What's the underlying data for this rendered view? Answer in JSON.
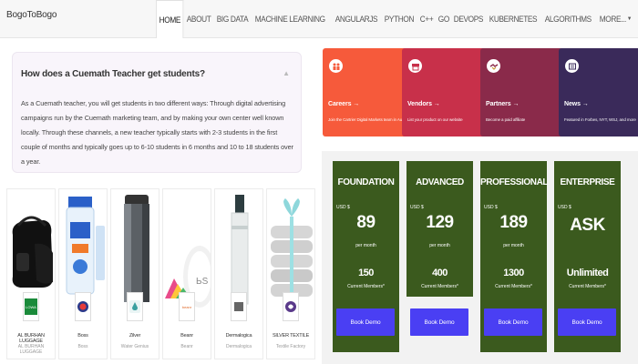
{
  "brand": "BogoToBogo",
  "nav": [
    {
      "label": "HOME",
      "active": true
    },
    {
      "label": "ABOUT"
    },
    {
      "label": "BIG DATA"
    },
    {
      "label": "MACHINE LEARNING"
    },
    {
      "label": "ANGULARJS"
    },
    {
      "label": "PYTHON"
    },
    {
      "label": "C++"
    },
    {
      "label": "GO"
    },
    {
      "label": "DEVOPS"
    },
    {
      "label": "KUBERNETES"
    },
    {
      "label": "ALGORITHMS"
    },
    {
      "label": "MORE..."
    }
  ],
  "faq": {
    "question": "How does a Cuemath Teacher get students?",
    "answer": "As a Cuemath teacher, you will get students in two different ways: Through digital advertising campaigns run by the Cuemath marketing team, and by making your own center well known locally. Through these channels, a new teacher typically starts with 2-3 students in the first couple of months and typically goes up to 6-10 students in 6 months and 10 to 18 students over a year."
  },
  "products": [
    {
      "name": "AL BURHAN LUGGAGE",
      "sub": "AL BURHAN LUGGAGE",
      "logo_text": "LOWA",
      "logo_color": "#1a8a3a"
    },
    {
      "name": "Boss",
      "sub": "Boss",
      "logo_text": "BOSS",
      "logo_color": "#2b3a8a"
    },
    {
      "name": "Zilver",
      "sub": "Water Genius",
      "logo_text": "",
      "logo_color": "#3aa0a0"
    },
    {
      "name": "Beanr",
      "sub": "Beanr",
      "logo_text": "beanr",
      "logo_color": "#e06a2a"
    },
    {
      "name": "Dermalogica",
      "sub": "Dermalogica",
      "logo_text": "",
      "logo_color": "#666666"
    },
    {
      "name": "SILVER TEXTILE",
      "sub": "Textile Factory",
      "logo_text": "",
      "logo_color": "#5a3a8a"
    }
  ],
  "tiles": [
    {
      "title": "Careers →",
      "desc": "Join the Cartrier Digital Markets team in Austin",
      "color": "#f65a3b",
      "icon": "people-icon"
    },
    {
      "title": "Vendors →",
      "desc": "List your product on our website",
      "color": "#c8304a",
      "icon": "store-icon"
    },
    {
      "title": "Partners →",
      "desc": "Become a paid affiliate",
      "color": "#8a2a4a",
      "icon": "handshake-icon"
    },
    {
      "title": "News →",
      "desc": "Featured in Forbes, NYT, WSJ, and more",
      "color": "#3a2a5a",
      "icon": "newspaper-icon"
    }
  ],
  "plans": [
    {
      "name": "FOUNDATION",
      "currency": "USD $",
      "price": "89",
      "per": "per month",
      "members": "150",
      "members_label": "Current Members*",
      "button": "Book Demo"
    },
    {
      "name": "ADVANCED",
      "currency": "USD $",
      "price": "129",
      "per": "per month",
      "members": "400",
      "members_label": "Current Members*",
      "button": "Book Demo"
    },
    {
      "name": "PROFESSIONAL",
      "currency": "USD $",
      "price": "189",
      "per": "per month",
      "members": "1300",
      "members_label": "Current Members*",
      "button": "Book Demo"
    },
    {
      "name": "ENTERPRISE",
      "currency": "USD $",
      "price": "ASK",
      "per": "",
      "members": "Unlimited",
      "members_label": "Current Members*",
      "button": "Book Demo"
    }
  ]
}
